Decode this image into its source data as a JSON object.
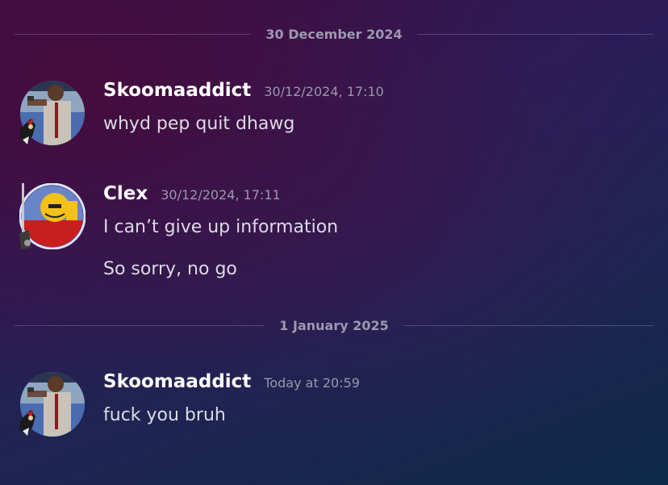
{
  "dividers": [
    {
      "date": "30 December 2024"
    },
    {
      "date": "1 January 2025"
    }
  ],
  "messages": [
    {
      "username": "Skoomaaddict",
      "timestamp": "30/12/2024, 17:10",
      "lines": [
        "whyd pep quit dhawg"
      ]
    },
    {
      "username": "Clex",
      "timestamp": "30/12/2024, 17:11",
      "lines": [
        "I can’t give up information",
        "So sorry, no go"
      ]
    },
    {
      "username": "Skoomaaddict",
      "timestamp": "Today at 20:59",
      "lines": [
        "fuck you bruh"
      ]
    }
  ]
}
